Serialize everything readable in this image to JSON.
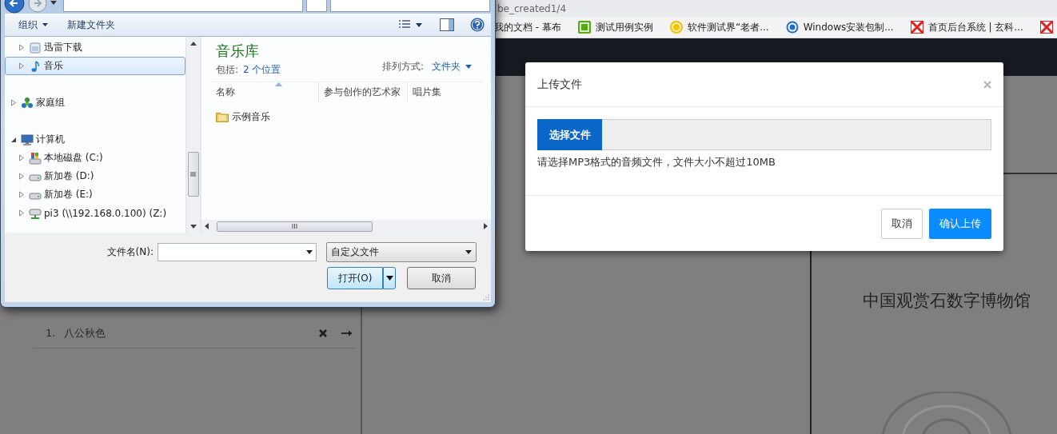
{
  "browser": {
    "tab_title": "be_created1/4",
    "bookmarks": [
      {
        "kind": "hidden",
        "label": "我的文档 - 幕布"
      },
      {
        "kind": "tile",
        "label": "测试用例实例"
      },
      {
        "kind": "coin",
        "label": "软件测试界“老者..."
      },
      {
        "kind": "ring",
        "label": "Windows安装包制..."
      },
      {
        "kind": "flag",
        "label": "首页后台系统 | 玄科..."
      },
      {
        "kind": "flag"
      }
    ]
  },
  "page": {
    "playlist": [
      {
        "number": "1.",
        "title": "八公秋色"
      }
    ],
    "museum_title": "中国观赏石数字博物馆"
  },
  "file_dialog": {
    "toolbar": {
      "organize": "组织",
      "new_folder": "新建文件夹"
    },
    "nav_tree": [
      {
        "children": [
          {
            "label": "迅雷下载",
            "kind": "download",
            "expanded": false,
            "selected": false
          },
          {
            "label": "音乐",
            "kind": "music",
            "expanded": false,
            "selected": true
          }
        ]
      },
      {
        "label": "家庭组",
        "kind": "homegroup",
        "expanded": false,
        "selected": false
      },
      {
        "label": "计算机",
        "kind": "computer",
        "expanded": true,
        "selected": false,
        "children": [
          {
            "label": "本地磁盘 (C:)",
            "kind": "system-drive",
            "expanded": false,
            "selected": false
          },
          {
            "label": "新加卷 (D:)",
            "kind": "drive",
            "expanded": false,
            "selected": false
          },
          {
            "label": "新加卷 (E:)",
            "kind": "drive",
            "expanded": false,
            "selected": false
          },
          {
            "label": "pi3 (\\\\192.168.0.100) (Z:)",
            "kind": "network-drive",
            "expanded": false,
            "selected": false
          }
        ]
      }
    ],
    "library": {
      "title": "音乐库",
      "includes_label": "包括:",
      "includes_link": "2 个位置",
      "arrange_label": "排列方式:",
      "arrange_value": "文件夹"
    },
    "columns": [
      "名称",
      "参与创作的艺术家",
      "唱片集"
    ],
    "items": [
      {
        "name": "示例音乐"
      }
    ],
    "filename_label": "文件名(N):",
    "file_type": "自定义文件",
    "open_button": "打开(O)",
    "cancel_button": "取消"
  },
  "upload_modal": {
    "title": "上传文件",
    "choose_button": "选择文件",
    "hint": "请选择MP3格式的音频文件，文件大小不超过10MB",
    "buttons": [
      {
        "label": "取消",
        "kind": "default"
      },
      {
        "label": "确认上传",
        "kind": "primary"
      }
    ]
  }
}
